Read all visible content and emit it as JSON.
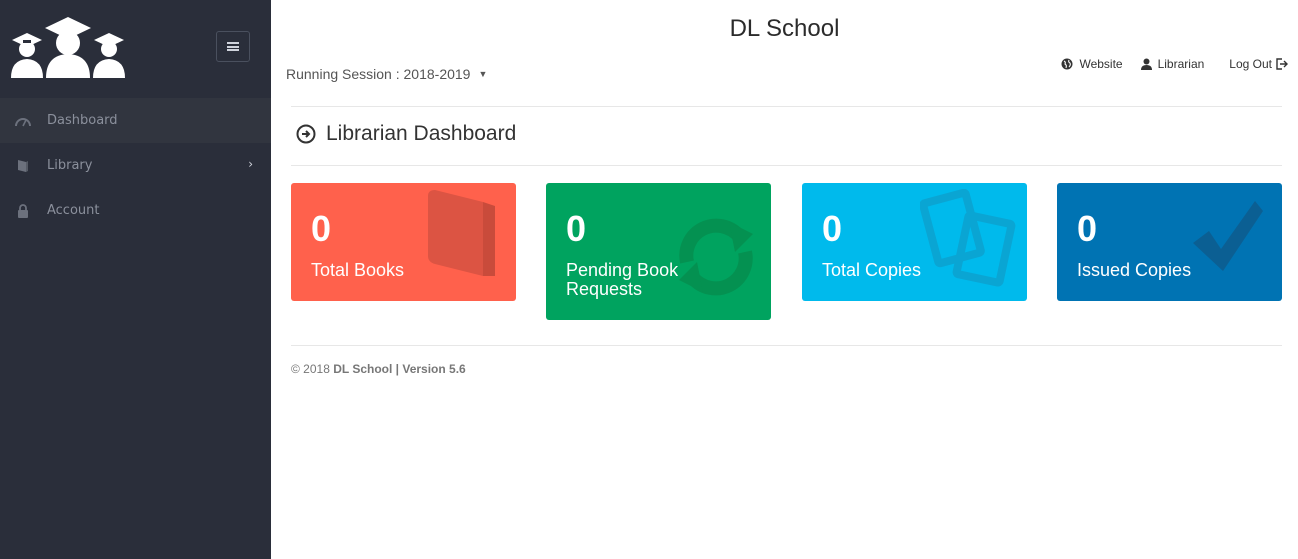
{
  "sidebar": {
    "items": [
      {
        "label": "Dashboard",
        "icon": "dashboard-icon"
      },
      {
        "label": "Library",
        "icon": "book-icon"
      },
      {
        "label": "Account",
        "icon": "lock-icon"
      }
    ]
  },
  "header": {
    "title": "DL School",
    "session_label": "Running Session : 2018-2019",
    "nav": {
      "website": "Website",
      "user": "Librarian",
      "logout": "Log Out"
    }
  },
  "page": {
    "heading": "Librarian Dashboard"
  },
  "cards": [
    {
      "value": "0",
      "label": "Total Books",
      "color": "#ff614c",
      "icon": "book-icon"
    },
    {
      "value": "0",
      "label": "Pending Book Requests",
      "color": "#00a35f",
      "icon": "refresh-icon"
    },
    {
      "value": "0",
      "label": "Total Copies",
      "color": "#00baec",
      "icon": "copy-icon"
    },
    {
      "value": "0",
      "label": "Issued Copies",
      "color": "#0073b3",
      "icon": "check-icon"
    }
  ],
  "footer": {
    "copyright": "© 2018",
    "brand": "DL School | Version 5.6"
  },
  "colors": {
    "sidebar_bg": "#2a2e3a",
    "active_item_bg": "#31353f"
  }
}
